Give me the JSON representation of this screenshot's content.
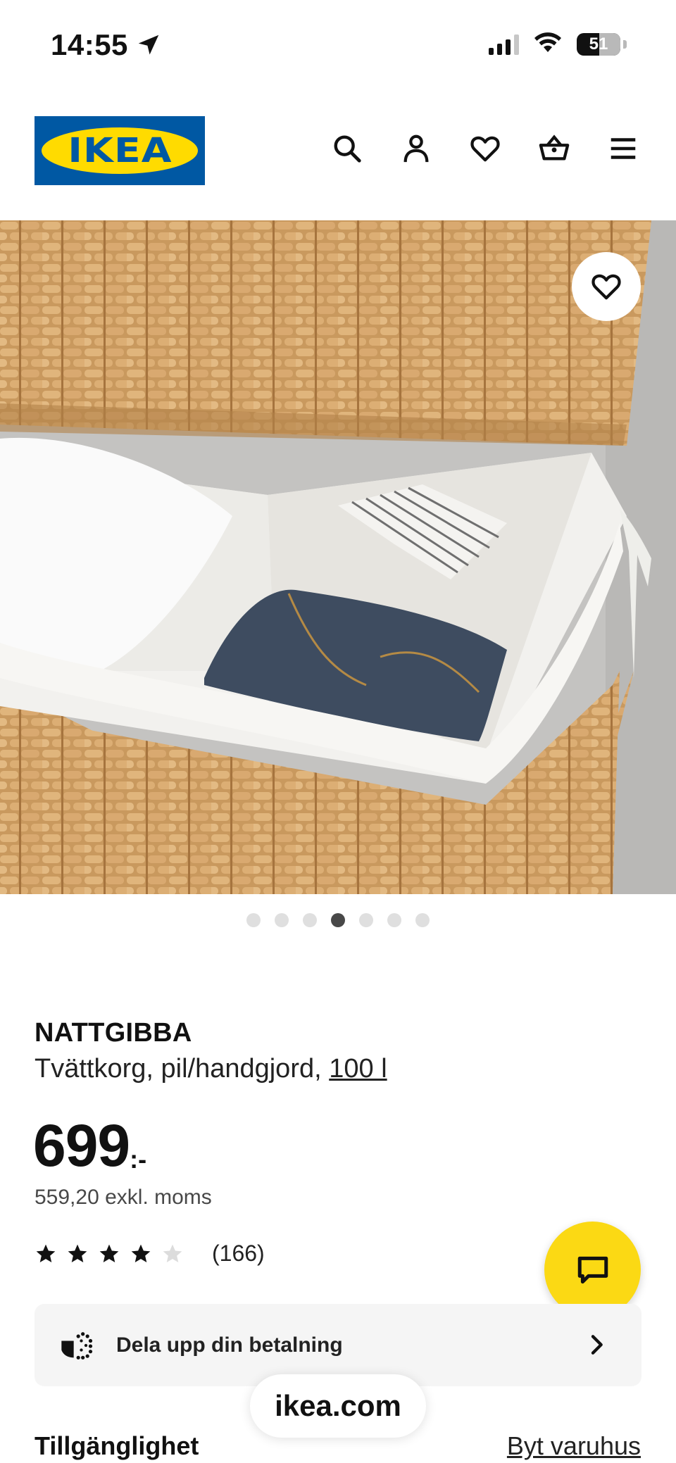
{
  "status_bar": {
    "time": "14:55",
    "battery_level": "51",
    "icons": [
      "location-arrow-icon",
      "signal-icon",
      "wifi-icon",
      "battery-icon"
    ]
  },
  "header": {
    "logo_text": "IKEA",
    "icons": [
      "search-icon",
      "profile-icon",
      "heart-icon",
      "basket-icon",
      "menu-icon"
    ]
  },
  "gallery": {
    "total_images": 7,
    "active_index": 4
  },
  "product": {
    "name": "NATTGIBBA",
    "description_prefix": "Tvättkorg, pil/handgjord, ",
    "volume": "100 l",
    "price_main": "699",
    "price_suffix": ":-",
    "price_exkl": "559,20 exkl. moms",
    "rating_stars": 4,
    "rating_max": 5,
    "rating_count": "(166)"
  },
  "payment": {
    "label": "Dela upp din betalning"
  },
  "browser": {
    "url": "ikea.com"
  },
  "availability": {
    "title": "Tillgänglighet",
    "change_store": "Byt varuhus"
  },
  "colors": {
    "ikea_blue": "#0058a3",
    "ikea_yellow": "#ffdb00",
    "chat_yellow": "#fbd914"
  }
}
